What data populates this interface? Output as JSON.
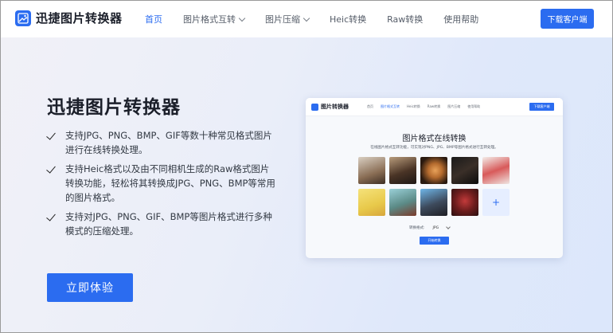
{
  "header": {
    "logo_text": "迅捷图片转换器",
    "nav": [
      {
        "label": "首页",
        "active": true,
        "dropdown": false
      },
      {
        "label": "图片格式互转",
        "active": false,
        "dropdown": true
      },
      {
        "label": "图片压缩",
        "active": false,
        "dropdown": true
      },
      {
        "label": "Heic转换",
        "active": false,
        "dropdown": false
      },
      {
        "label": "Raw转换",
        "active": false,
        "dropdown": false
      },
      {
        "label": "使用帮助",
        "active": false,
        "dropdown": false
      }
    ],
    "download_label": "下载客户端"
  },
  "hero": {
    "title": "迅捷图片转换器",
    "features": [
      "支持JPG、PNG、BMP、GIF等数十种常见格式图片进行在线转换处理。",
      "支持Heic格式以及由不同相机生成的Raw格式图片转换功能，轻松将其转换成JPG、PNG、BMP等常用的图片格式。",
      "支持对JPG、PNG、GIF、BMP等图片格式进行多种模式的压缩处理。"
    ],
    "cta_label": "立即体验"
  },
  "preview": {
    "logo_text": "图片转换器",
    "nav": [
      "首页",
      "图片格式互转",
      "Heic转换",
      "Raw转换",
      "图片压缩",
      "使用帮助"
    ],
    "nav_active_index": 1,
    "download_label": "下载客户端",
    "title": "图片格式在线转换",
    "subtitle": "在线图片格式互转功能，可实现对PNG、JPG、BMP等图片格式进行互转处理。",
    "thumbs_row1": [
      "photo-1",
      "photo-2",
      "photo-3",
      "photo-4",
      "photo-5"
    ],
    "thumbs_row2": [
      "photo-6",
      "photo-7",
      "photo-8",
      "photo-9"
    ],
    "add_label": "+",
    "format_label": "转换格式:",
    "format_value": "JPG",
    "start_label": "开始转换"
  },
  "colors": {
    "accent": "#2b6cf0"
  }
}
